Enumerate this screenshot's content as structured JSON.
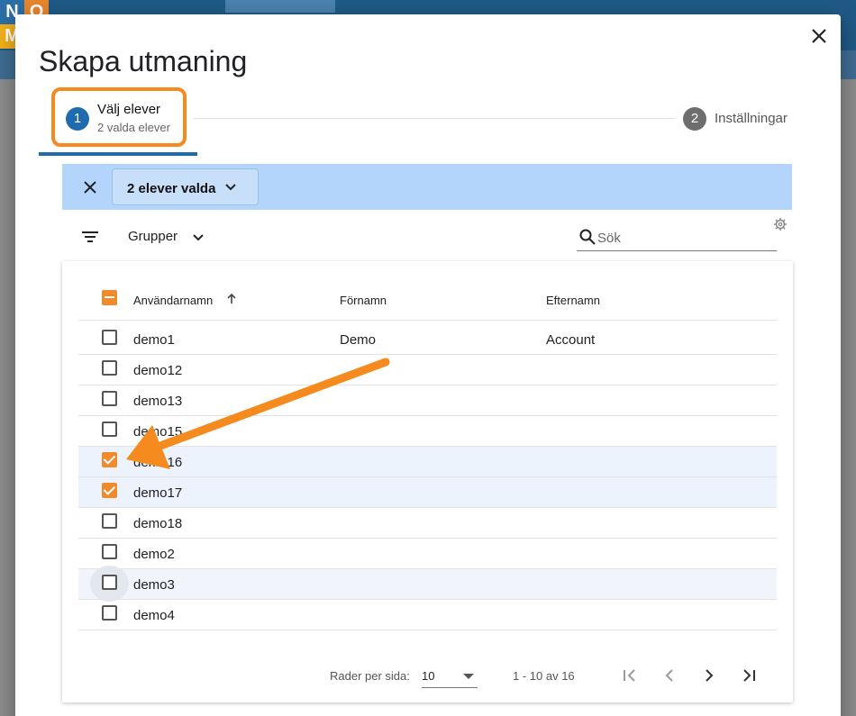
{
  "background": {
    "tile_letters": [
      "N",
      "O",
      "M"
    ]
  },
  "dialog": {
    "title": "Skapa utmaning",
    "close_icon": "close-icon"
  },
  "stepper": {
    "step1": {
      "number": "1",
      "label": "Välj elever",
      "sublabel": "2 valda elever"
    },
    "step2": {
      "number": "2",
      "label": "Inställningar"
    }
  },
  "selection_bar": {
    "dropdown_label": "2 elever valda"
  },
  "toolbar": {
    "groups_label": "Grupper",
    "search_placeholder": "Sök"
  },
  "table": {
    "columns": [
      "Användarnamn",
      "Förnamn",
      "Efternamn"
    ],
    "rows": [
      {
        "username": "demo1",
        "firstname": "Demo",
        "lastname": "Account",
        "checked": false
      },
      {
        "username": "demo12",
        "firstname": "",
        "lastname": "",
        "checked": false
      },
      {
        "username": "demo13",
        "firstname": "",
        "lastname": "",
        "checked": false
      },
      {
        "username": "demo15",
        "firstname": "",
        "lastname": "",
        "checked": false
      },
      {
        "username": "demo16",
        "firstname": "",
        "lastname": "",
        "checked": true
      },
      {
        "username": "demo17",
        "firstname": "",
        "lastname": "",
        "checked": true
      },
      {
        "username": "demo18",
        "firstname": "",
        "lastname": "",
        "checked": false
      },
      {
        "username": "demo2",
        "firstname": "",
        "lastname": "",
        "checked": false
      },
      {
        "username": "demo3",
        "firstname": "",
        "lastname": "",
        "checked": false
      },
      {
        "username": "demo4",
        "firstname": "",
        "lastname": "",
        "checked": false
      }
    ]
  },
  "pagination": {
    "rows_per_page_label": "Rader per sida:",
    "rows_per_page_value": "10",
    "range": "1 - 10 av 16"
  },
  "colors": {
    "accent_orange": "#f58a1f",
    "primary_blue": "#1e6bb0",
    "selection_bar_bg": "#b3d4fb",
    "checkbox_checked": "#f08a2a"
  }
}
